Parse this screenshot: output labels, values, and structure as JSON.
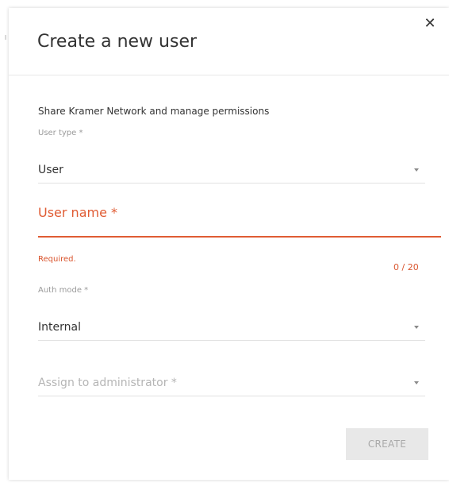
{
  "dialog": {
    "title": "Create a new user",
    "close_icon": "close-icon",
    "intro_text": "Share Kramer Network and manage permissions",
    "create_button_label": "CREATE"
  },
  "fields": {
    "user_type": {
      "label": "User type *",
      "value": "User"
    },
    "user_name": {
      "label": "User name *",
      "error": "Required.",
      "counter": "0 / 20"
    },
    "auth_mode": {
      "label": "Auth mode *",
      "value": "Internal"
    },
    "assign_admin": {
      "placeholder": "Assign to administrator *"
    }
  },
  "colors": {
    "accent_error": "#e05c34",
    "text": "#333333",
    "muted": "#9a9a9a",
    "disabled_button_bg": "#e8e8e8"
  }
}
